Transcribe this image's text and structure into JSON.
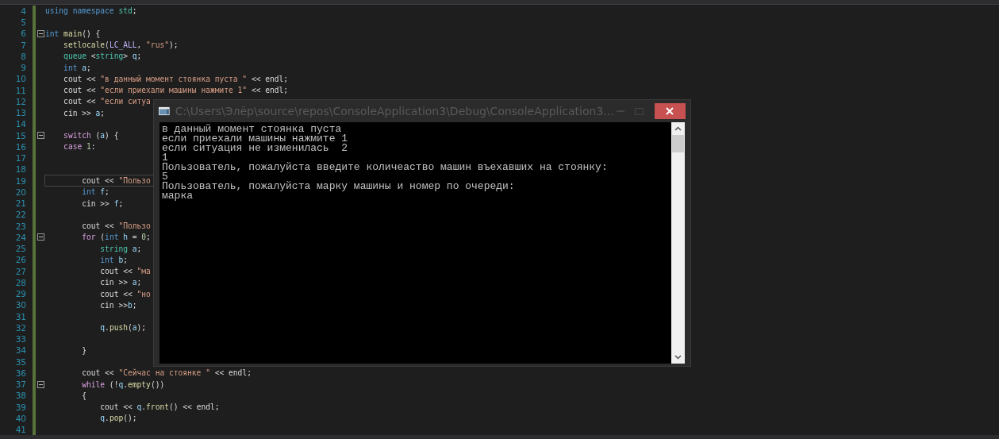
{
  "editor": {
    "lines": [
      {
        "number": "4",
        "tokens": [
          {
            "kind": "kw",
            "text": "using "
          },
          {
            "kind": "kw",
            "text": "namespace "
          },
          {
            "kind": "type",
            "text": "std"
          },
          {
            "kind": "plain",
            "text": ";"
          }
        ]
      },
      {
        "number": "5"
      },
      {
        "number": "6",
        "expanded": true,
        "tokens": [
          {
            "kind": "kw",
            "text": "int "
          },
          {
            "kind": "fn",
            "text": "main"
          },
          {
            "kind": "plain",
            "text": "() {"
          }
        ]
      },
      {
        "number": "7",
        "tokens": [
          {
            "kind": "fn",
            "text": "    setlocale"
          },
          {
            "kind": "plain",
            "text": "("
          },
          {
            "kind": "macro",
            "text": "LC_ALL"
          },
          {
            "kind": "plain",
            "text": ", "
          },
          {
            "kind": "str",
            "text": "\"rus\""
          },
          {
            "kind": "plain",
            "text": ");"
          }
        ]
      },
      {
        "number": "8",
        "tokens": [
          {
            "kind": "type",
            "text": "    queue"
          },
          {
            "kind": "plain",
            "text": " <"
          },
          {
            "kind": "type",
            "text": "string"
          },
          {
            "kind": "plain",
            "text": "> "
          },
          {
            "kind": "var",
            "text": "q"
          },
          {
            "kind": "plain",
            "text": ";"
          }
        ]
      },
      {
        "number": "9",
        "tokens": [
          {
            "kind": "kw",
            "text": "    int "
          },
          {
            "kind": "var",
            "text": "a"
          },
          {
            "kind": "plain",
            "text": ";"
          }
        ]
      },
      {
        "number": "10",
        "tokens": [
          {
            "kind": "plain",
            "text": "    cout << "
          },
          {
            "kind": "str",
            "text": "\"в данный момент стоянка пуста \""
          },
          {
            "kind": "plain",
            "text": " << endl;"
          }
        ]
      },
      {
        "number": "11",
        "tokens": [
          {
            "kind": "plain",
            "text": "    cout << "
          },
          {
            "kind": "str",
            "text": "\"если приехали машины нажмите 1\""
          },
          {
            "kind": "plain",
            "text": " << endl;"
          }
        ]
      },
      {
        "number": "12",
        "tokens": [
          {
            "kind": "plain",
            "text": "    cout << "
          },
          {
            "kind": "str",
            "text": "\"если ситуа"
          }
        ]
      },
      {
        "number": "13",
        "tokens": [
          {
            "kind": "plain",
            "text": "    cin >> "
          },
          {
            "kind": "var",
            "text": "a"
          },
          {
            "kind": "plain",
            "text": ";"
          }
        ]
      },
      {
        "number": "14"
      },
      {
        "number": "15",
        "expanded": true,
        "tokens": [
          {
            "kind": "ctl",
            "text": "    switch"
          },
          {
            "kind": "plain",
            "text": " ("
          },
          {
            "kind": "var",
            "text": "a"
          },
          {
            "kind": "plain",
            "text": ") {"
          }
        ]
      },
      {
        "number": "16",
        "tokens": [
          {
            "kind": "ctl",
            "text": "    case "
          },
          {
            "kind": "num",
            "text": "1"
          },
          {
            "kind": "plain",
            "text": ":"
          }
        ]
      },
      {
        "number": "17"
      },
      {
        "number": "18"
      },
      {
        "number": "19",
        "current": true,
        "tokens": [
          {
            "kind": "plain",
            "text": "        cout << "
          },
          {
            "kind": "str",
            "text": "\"Пользо"
          }
        ]
      },
      {
        "number": "20",
        "tokens": [
          {
            "kind": "kw",
            "text": "        int "
          },
          {
            "kind": "var",
            "text": "f"
          },
          {
            "kind": "plain",
            "text": ";"
          }
        ]
      },
      {
        "number": "21",
        "tokens": [
          {
            "kind": "plain",
            "text": "        cin >> "
          },
          {
            "kind": "var",
            "text": "f"
          },
          {
            "kind": "plain",
            "text": ";"
          }
        ]
      },
      {
        "number": "22"
      },
      {
        "number": "23",
        "tokens": [
          {
            "kind": "plain",
            "text": "        cout << "
          },
          {
            "kind": "str",
            "text": "\"Пользо"
          }
        ]
      },
      {
        "number": "24",
        "expanded": true,
        "tokens": [
          {
            "kind": "ctl",
            "text": "        for"
          },
          {
            "kind": "plain",
            "text": " ("
          },
          {
            "kind": "kw",
            "text": "int "
          },
          {
            "kind": "var",
            "text": "h"
          },
          {
            "kind": "plain",
            "text": " = "
          },
          {
            "kind": "num",
            "text": "0"
          },
          {
            "kind": "plain",
            "text": ";"
          }
        ]
      },
      {
        "number": "25",
        "tokens": [
          {
            "kind": "type",
            "text": "            string "
          },
          {
            "kind": "var",
            "text": "a"
          },
          {
            "kind": "plain",
            "text": ";"
          }
        ]
      },
      {
        "number": "26",
        "tokens": [
          {
            "kind": "kw",
            "text": "            int "
          },
          {
            "kind": "var",
            "text": "b"
          },
          {
            "kind": "plain",
            "text": ";"
          }
        ]
      },
      {
        "number": "27",
        "tokens": [
          {
            "kind": "plain",
            "text": "            cout << "
          },
          {
            "kind": "str",
            "text": "\"ма"
          }
        ]
      },
      {
        "number": "28",
        "tokens": [
          {
            "kind": "plain",
            "text": "            cin >> "
          },
          {
            "kind": "var",
            "text": "a"
          },
          {
            "kind": "plain",
            "text": ";"
          }
        ]
      },
      {
        "number": "29",
        "tokens": [
          {
            "kind": "plain",
            "text": "            cout << "
          },
          {
            "kind": "str",
            "text": "\"но"
          }
        ]
      },
      {
        "number": "30",
        "tokens": [
          {
            "kind": "plain",
            "text": "            cin >>"
          },
          {
            "kind": "var",
            "text": "b"
          },
          {
            "kind": "plain",
            "text": ";"
          }
        ]
      },
      {
        "number": "31"
      },
      {
        "number": "32",
        "tokens": [
          {
            "kind": "var",
            "text": "            q"
          },
          {
            "kind": "plain",
            "text": "."
          },
          {
            "kind": "fn",
            "text": "push"
          },
          {
            "kind": "plain",
            "text": "("
          },
          {
            "kind": "var",
            "text": "a"
          },
          {
            "kind": "plain",
            "text": ");"
          }
        ]
      },
      {
        "number": "33"
      },
      {
        "number": "34",
        "tokens": [
          {
            "kind": "plain",
            "text": "        }"
          }
        ]
      },
      {
        "number": "35"
      },
      {
        "number": "36",
        "tokens": [
          {
            "kind": "plain",
            "text": "        cout << "
          },
          {
            "kind": "str",
            "text": "\"Сейчас на стоянке \""
          },
          {
            "kind": "plain",
            "text": " << endl;"
          }
        ]
      },
      {
        "number": "37",
        "expanded": true,
        "tokens": [
          {
            "kind": "ctl",
            "text": "        while"
          },
          {
            "kind": "plain",
            "text": " (!"
          },
          {
            "kind": "var",
            "text": "q"
          },
          {
            "kind": "plain",
            "text": "."
          },
          {
            "kind": "fn",
            "text": "empty"
          },
          {
            "kind": "plain",
            "text": "())"
          }
        ]
      },
      {
        "number": "38",
        "tokens": [
          {
            "kind": "plain",
            "text": "        {"
          }
        ]
      },
      {
        "number": "39",
        "tokens": [
          {
            "kind": "plain",
            "text": "            cout << "
          },
          {
            "kind": "var",
            "text": "q"
          },
          {
            "kind": "plain",
            "text": "."
          },
          {
            "kind": "fn",
            "text": "front"
          },
          {
            "kind": "plain",
            "text": "() << endl;"
          }
        ]
      },
      {
        "number": "40",
        "tokens": [
          {
            "kind": "var",
            "text": "            q"
          },
          {
            "kind": "plain",
            "text": "."
          },
          {
            "kind": "fn",
            "text": "pop"
          },
          {
            "kind": "plain",
            "text": "();"
          }
        ]
      },
      {
        "number": "41"
      }
    ]
  },
  "console": {
    "title": "C:\\Users\\Элёр\\source\\repos\\ConsoleApplication3\\Debug\\ConsoleApplication3...",
    "output": [
      "в данный момент стоянка пуста",
      "если приехали машины нажмите 1",
      "если ситуация не изменилась  2",
      "1",
      "Пользователь, пожалуйста введите количеаство машин въехавших на стоянку:",
      "5",
      "Пользователь, пожалуйста марку машины и номер по очереди:",
      "марка"
    ]
  }
}
